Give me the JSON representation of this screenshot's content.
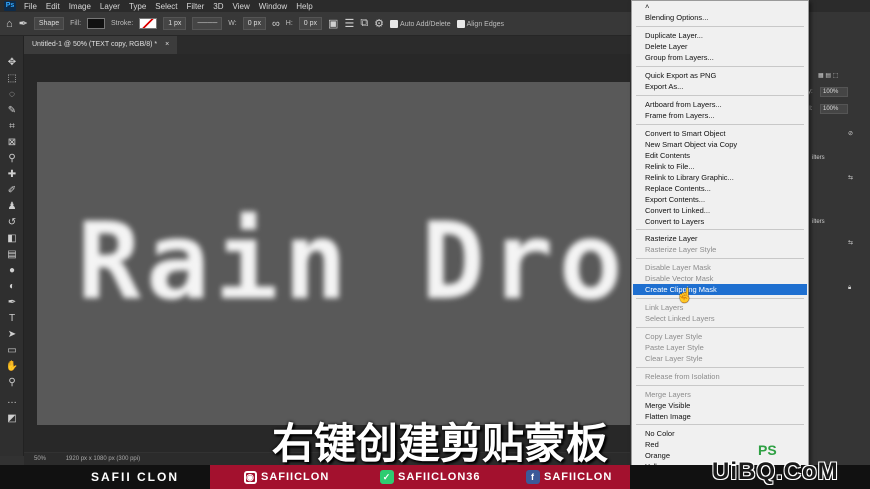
{
  "menubar": {
    "logo": "Ps",
    "items": [
      "File",
      "Edit",
      "Image",
      "Layer",
      "Type",
      "Select",
      "Filter",
      "3D",
      "View",
      "Window",
      "Help"
    ]
  },
  "options_bar": {
    "mode": "Shape",
    "fill_label": "Fill:",
    "stroke_label": "Stroke:",
    "stroke_width": "1 px",
    "w_label": "W:",
    "w_value": "0 px",
    "h_label": "H:",
    "h_value": "0 px",
    "auto_add_delete": "Auto Add/Delete",
    "align_edges": "Align Edges"
  },
  "document": {
    "tab_title": "Untitled-1 @ 50% (TEXT copy, RGB/8) *",
    "canvas_text": "Rain Drop",
    "zoom": "50%",
    "doc_info": "1920 px x 1080 px (300 ppi)"
  },
  "subtitle": "右键创建剪贴蒙板",
  "right_panel": {
    "opacity_label": "y:",
    "opacity_value": "100%",
    "fill_label": "ll:",
    "fill_value": "100%",
    "filters_1": "ilters",
    "filters_2": "ilters"
  },
  "context_menu": {
    "items": [
      {
        "label": "Blending Options...",
        "state": "enabled"
      },
      {
        "label": "Duplicate Layer...",
        "state": "enabled"
      },
      {
        "label": "Delete Layer",
        "state": "enabled"
      },
      {
        "label": "Group from Layers...",
        "state": "enabled"
      },
      {
        "label": "Quick Export as PNG",
        "state": "enabled"
      },
      {
        "label": "Export As...",
        "state": "enabled"
      },
      {
        "label": "Artboard from Layers...",
        "state": "enabled"
      },
      {
        "label": "Frame from Layers...",
        "state": "enabled"
      },
      {
        "label": "Convert to Smart Object",
        "state": "enabled"
      },
      {
        "label": "New Smart Object via Copy",
        "state": "enabled"
      },
      {
        "label": "Edit Contents",
        "state": "enabled"
      },
      {
        "label": "Relink to File...",
        "state": "enabled"
      },
      {
        "label": "Relink to Library Graphic...",
        "state": "enabled"
      },
      {
        "label": "Replace Contents...",
        "state": "enabled"
      },
      {
        "label": "Export Contents...",
        "state": "enabled"
      },
      {
        "label": "Convert to Linked...",
        "state": "enabled"
      },
      {
        "label": "Convert to Layers",
        "state": "enabled"
      },
      {
        "label": "Rasterize Layer",
        "state": "enabled"
      },
      {
        "label": "Rasterize Layer Style",
        "state": "disabled"
      },
      {
        "label": "Disable Layer Mask",
        "state": "disabled"
      },
      {
        "label": "Disable Vector Mask",
        "state": "disabled"
      },
      {
        "label": "Create Clipping Mask",
        "state": "highlighted"
      },
      {
        "label": "Link Layers",
        "state": "disabled"
      },
      {
        "label": "Select Linked Layers",
        "state": "disabled"
      },
      {
        "label": "Copy Layer Style",
        "state": "disabled"
      },
      {
        "label": "Paste Layer Style",
        "state": "disabled"
      },
      {
        "label": "Clear Layer Style",
        "state": "disabled"
      },
      {
        "label": "Release from Isolation",
        "state": "disabled"
      },
      {
        "label": "Merge Layers",
        "state": "disabled"
      },
      {
        "label": "Merge Visible",
        "state": "enabled"
      },
      {
        "label": "Flatten Image",
        "state": "enabled"
      },
      {
        "label": "No Color",
        "state": "enabled"
      },
      {
        "label": "Red",
        "state": "enabled"
      },
      {
        "label": "Orange",
        "state": "enabled"
      },
      {
        "label": "Yellow",
        "state": "enabled"
      }
    ]
  },
  "footer": {
    "name": "SAFII CLON",
    "instagram": "SAFIICLON",
    "vine": "SAFIICLON36",
    "facebook": "SAFIICLON",
    "accent_color": "#a3112e"
  },
  "watermark": {
    "ps_text": "PS",
    "site": "UiBQ.CoM"
  }
}
